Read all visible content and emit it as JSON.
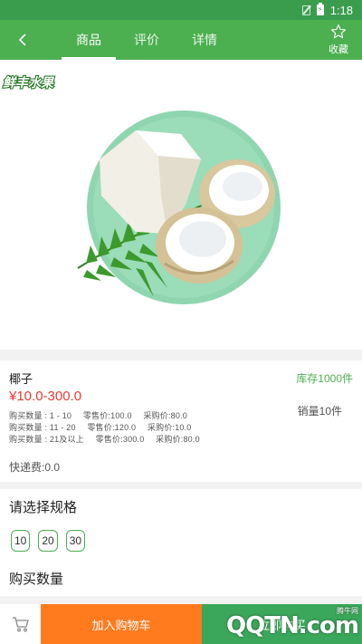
{
  "status_bar": {
    "time": "1:18"
  },
  "topbar": {
    "tabs": [
      {
        "label": "商品",
        "active": true
      },
      {
        "label": "评价",
        "active": false
      },
      {
        "label": "详情",
        "active": false
      }
    ],
    "favorite_label": "收藏",
    "icons": {
      "back": "back-arrow-icon",
      "favorite": "star-outline-icon"
    }
  },
  "product_image": {
    "brand_logo": "鲜丰水果"
  },
  "product": {
    "name": "椰子",
    "price_range": "¥10.0-300.0",
    "tiers": [
      {
        "qty": "购买数量 : 1 - 10",
        "retail": "零售价:100.0",
        "purchase": "采购价:80.0"
      },
      {
        "qty": "购买数量 : 11 - 20",
        "retail": "零售价:120.0",
        "purchase": "采购价:10.0"
      },
      {
        "qty": "购买数量 : 21及以上",
        "retail": "零售价:300.0",
        "purchase": "采购价:80.0"
      }
    ],
    "stock": "库存1000件",
    "sales": "销量10件",
    "shipping": "快递费:0.0"
  },
  "spec": {
    "title": "请选择规格",
    "options": [
      "10",
      "20",
      "30"
    ],
    "quantity_title": "购买数量"
  },
  "bottom_bar": {
    "add_to_cart": "加入购物车",
    "buy_now": "立即购买"
  },
  "watermark": {
    "logo_text": "QQTN.com",
    "sub_text": "腾牛网"
  },
  "colors": {
    "primary_green": "#4caf50",
    "status_bar_green": "#3a9d4e",
    "price_red": "#e53935",
    "add_cart_orange": "#ff7b1e",
    "buy_now_green": "#3aa75a"
  }
}
